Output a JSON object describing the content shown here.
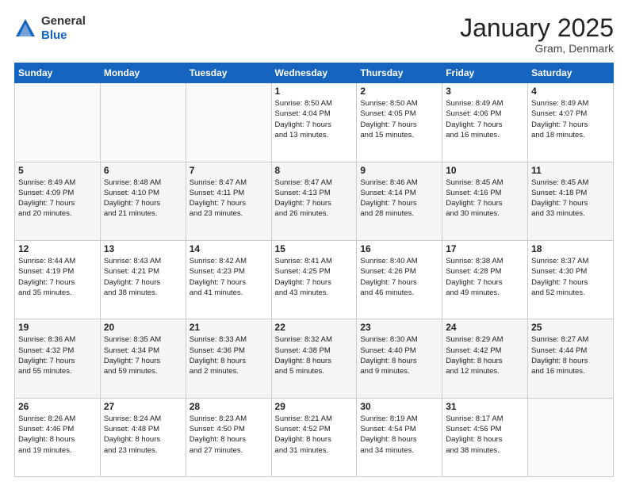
{
  "header": {
    "logo_line1": "General",
    "logo_line2": "Blue",
    "month": "January 2025",
    "location": "Gram, Denmark"
  },
  "weekdays": [
    "Sunday",
    "Monday",
    "Tuesday",
    "Wednesday",
    "Thursday",
    "Friday",
    "Saturday"
  ],
  "weeks": [
    [
      {
        "day": "",
        "info": ""
      },
      {
        "day": "",
        "info": ""
      },
      {
        "day": "",
        "info": ""
      },
      {
        "day": "1",
        "info": "Sunrise: 8:50 AM\nSunset: 4:04 PM\nDaylight: 7 hours\nand 13 minutes."
      },
      {
        "day": "2",
        "info": "Sunrise: 8:50 AM\nSunset: 4:05 PM\nDaylight: 7 hours\nand 15 minutes."
      },
      {
        "day": "3",
        "info": "Sunrise: 8:49 AM\nSunset: 4:06 PM\nDaylight: 7 hours\nand 16 minutes."
      },
      {
        "day": "4",
        "info": "Sunrise: 8:49 AM\nSunset: 4:07 PM\nDaylight: 7 hours\nand 18 minutes."
      }
    ],
    [
      {
        "day": "5",
        "info": "Sunrise: 8:49 AM\nSunset: 4:09 PM\nDaylight: 7 hours\nand 20 minutes."
      },
      {
        "day": "6",
        "info": "Sunrise: 8:48 AM\nSunset: 4:10 PM\nDaylight: 7 hours\nand 21 minutes."
      },
      {
        "day": "7",
        "info": "Sunrise: 8:47 AM\nSunset: 4:11 PM\nDaylight: 7 hours\nand 23 minutes."
      },
      {
        "day": "8",
        "info": "Sunrise: 8:47 AM\nSunset: 4:13 PM\nDaylight: 7 hours\nand 26 minutes."
      },
      {
        "day": "9",
        "info": "Sunrise: 8:46 AM\nSunset: 4:14 PM\nDaylight: 7 hours\nand 28 minutes."
      },
      {
        "day": "10",
        "info": "Sunrise: 8:45 AM\nSunset: 4:16 PM\nDaylight: 7 hours\nand 30 minutes."
      },
      {
        "day": "11",
        "info": "Sunrise: 8:45 AM\nSunset: 4:18 PM\nDaylight: 7 hours\nand 33 minutes."
      }
    ],
    [
      {
        "day": "12",
        "info": "Sunrise: 8:44 AM\nSunset: 4:19 PM\nDaylight: 7 hours\nand 35 minutes."
      },
      {
        "day": "13",
        "info": "Sunrise: 8:43 AM\nSunset: 4:21 PM\nDaylight: 7 hours\nand 38 minutes."
      },
      {
        "day": "14",
        "info": "Sunrise: 8:42 AM\nSunset: 4:23 PM\nDaylight: 7 hours\nand 41 minutes."
      },
      {
        "day": "15",
        "info": "Sunrise: 8:41 AM\nSunset: 4:25 PM\nDaylight: 7 hours\nand 43 minutes."
      },
      {
        "day": "16",
        "info": "Sunrise: 8:40 AM\nSunset: 4:26 PM\nDaylight: 7 hours\nand 46 minutes."
      },
      {
        "day": "17",
        "info": "Sunrise: 8:38 AM\nSunset: 4:28 PM\nDaylight: 7 hours\nand 49 minutes."
      },
      {
        "day": "18",
        "info": "Sunrise: 8:37 AM\nSunset: 4:30 PM\nDaylight: 7 hours\nand 52 minutes."
      }
    ],
    [
      {
        "day": "19",
        "info": "Sunrise: 8:36 AM\nSunset: 4:32 PM\nDaylight: 7 hours\nand 55 minutes."
      },
      {
        "day": "20",
        "info": "Sunrise: 8:35 AM\nSunset: 4:34 PM\nDaylight: 7 hours\nand 59 minutes."
      },
      {
        "day": "21",
        "info": "Sunrise: 8:33 AM\nSunset: 4:36 PM\nDaylight: 8 hours\nand 2 minutes."
      },
      {
        "day": "22",
        "info": "Sunrise: 8:32 AM\nSunset: 4:38 PM\nDaylight: 8 hours\nand 5 minutes."
      },
      {
        "day": "23",
        "info": "Sunrise: 8:30 AM\nSunset: 4:40 PM\nDaylight: 8 hours\nand 9 minutes."
      },
      {
        "day": "24",
        "info": "Sunrise: 8:29 AM\nSunset: 4:42 PM\nDaylight: 8 hours\nand 12 minutes."
      },
      {
        "day": "25",
        "info": "Sunrise: 8:27 AM\nSunset: 4:44 PM\nDaylight: 8 hours\nand 16 minutes."
      }
    ],
    [
      {
        "day": "26",
        "info": "Sunrise: 8:26 AM\nSunset: 4:46 PM\nDaylight: 8 hours\nand 19 minutes."
      },
      {
        "day": "27",
        "info": "Sunrise: 8:24 AM\nSunset: 4:48 PM\nDaylight: 8 hours\nand 23 minutes."
      },
      {
        "day": "28",
        "info": "Sunrise: 8:23 AM\nSunset: 4:50 PM\nDaylight: 8 hours\nand 27 minutes."
      },
      {
        "day": "29",
        "info": "Sunrise: 8:21 AM\nSunset: 4:52 PM\nDaylight: 8 hours\nand 31 minutes."
      },
      {
        "day": "30",
        "info": "Sunrise: 8:19 AM\nSunset: 4:54 PM\nDaylight: 8 hours\nand 34 minutes."
      },
      {
        "day": "31",
        "info": "Sunrise: 8:17 AM\nSunset: 4:56 PM\nDaylight: 8 hours\nand 38 minutes."
      },
      {
        "day": "",
        "info": ""
      }
    ]
  ]
}
